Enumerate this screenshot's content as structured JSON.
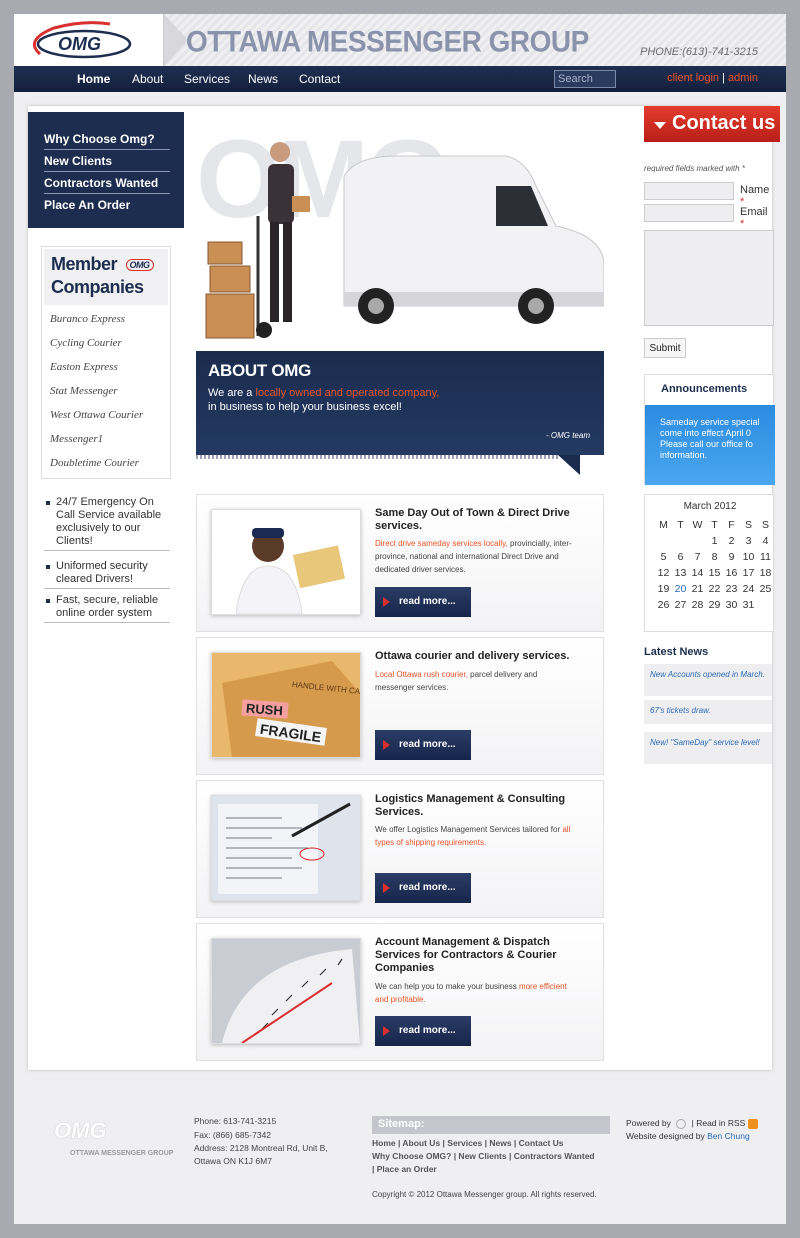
{
  "header": {
    "logo_text": "OMG",
    "title": "OTTAWA MESSENGER GROUP",
    "phone": "PHONE:(613)-741-3215"
  },
  "nav": {
    "items": [
      "Home",
      "About",
      "Services",
      "News",
      "Contact"
    ],
    "search_placeholder": "Search",
    "client_login": "client login",
    "separator": "|",
    "admin": "admin"
  },
  "left": {
    "links": [
      "Why Choose Omg?",
      "New Clients",
      "Contractors Wanted",
      "Place An Order"
    ],
    "members_title_1": "Member",
    "members_title_2": "Companies",
    "members_logo": "OMG",
    "members": [
      "Buranco Express",
      "Cycling Courier",
      "Easton Express",
      "Stat Messenger",
      "West Ottawa Courier",
      "Messenger1",
      "Doubletime Courier"
    ],
    "features": [
      "24/7 Emergency On Call Service available exclusively to our Clients!",
      "Uniformed security cleared Drivers!",
      "Fast, secure, reliable online order system"
    ]
  },
  "hero": {
    "watermark": "OMG"
  },
  "about": {
    "title": "ABOUT OMG",
    "line1_a": "We are a ",
    "line1_hl": "locally owned and operated company,",
    "line2": "in business to help your business excel!",
    "sign": "- OMG team"
  },
  "cards": [
    {
      "title": "Same Day Out of Town & Direct Drive services.",
      "desc_hl": "Direct drive sameday services locally,",
      "desc": " provincially, inter-province, national and international Direct Drive and dedicated driver services.",
      "button": "read more..."
    },
    {
      "title": "Ottawa courier and delivery services.",
      "desc_hl": "Local Ottawa rush courier,",
      "desc": " parcel delivery and messenger services.",
      "button": "read more..."
    },
    {
      "title": "Logistics Management & Consulting Services.",
      "desc_a": "We offer Logistics Management Services tailored for ",
      "desc_hl": "all types of shipping requirements.",
      "button": "read more..."
    },
    {
      "title": "Account Management & Dispatch Services for Contractors & Courier Companies",
      "desc_a": "We can help you to make your business ",
      "desc_hl": "more efficient and profitable.",
      "button": "read more..."
    }
  ],
  "card_images": [
    "RUSH",
    "FRAGILE",
    "HANDLE WITH CARE"
  ],
  "contact": {
    "title": "Contact us",
    "required": "required fields marked with *",
    "name_label": "Name",
    "email_label": "Email",
    "star": "*",
    "submit": "Submit"
  },
  "announcements": {
    "title": "Announcements",
    "lines": [
      "Sameday service special",
      "come into effect April 0",
      "Please call our office fo",
      "information."
    ]
  },
  "calendar": {
    "title": "March 2012",
    "days": [
      "M",
      "T",
      "W",
      "T",
      "F",
      "S",
      "S"
    ],
    "cells": [
      "",
      "",
      "",
      "1",
      "2",
      "3",
      "4",
      "5",
      "6",
      "7",
      "8",
      "9",
      "10",
      "11",
      "12",
      "13",
      "14",
      "15",
      "16",
      "17",
      "18",
      "19",
      "20",
      "21",
      "22",
      "23",
      "24",
      "25",
      "26",
      "27",
      "28",
      "29",
      "30",
      "31",
      ""
    ],
    "today": "20"
  },
  "news": {
    "title": "Latest News",
    "items": [
      "New Accounts opened in March.",
      "67's tickets draw.",
      "New! \"SameDay\" service level!"
    ]
  },
  "footer": {
    "logo": "OMG",
    "logo_sub": "OTTAWA MESSENGER GROUP",
    "phone": "Phone: 613-741-3215",
    "fax": "Fax: (866) 685-7342",
    "address1": "Address: 2128 Montreal Rd, Unit B,",
    "address2": "Ottawa ON K1J 6M7",
    "sitemap_title": "Sitemap:",
    "sitemap_line1": "Home | About Us | Services | News | Contact Us",
    "sitemap_line2": "Why Choose OMG? | New Clients | Contractors Wanted",
    "sitemap_line3": "| Place an Order",
    "copyright": "Copyright © 2012 Ottawa Messenger group. All rights reserved.",
    "powered_by": "Powered by",
    "read_rss": "Read in RSS",
    "designed_by": "Website designed by",
    "designer": "Ben Chung"
  },
  "colors": {
    "navy": "#1d2d4f",
    "accent_red": "#e8552a",
    "contact_red": "#d92f2f",
    "link_blue": "#2a6ab5",
    "announce_blue": "#3a99e8"
  },
  "icons": [
    "logo-swoosh-icon",
    "search-field",
    "rss-icon",
    "wordpress-icon",
    "play-arrow-icon"
  ]
}
